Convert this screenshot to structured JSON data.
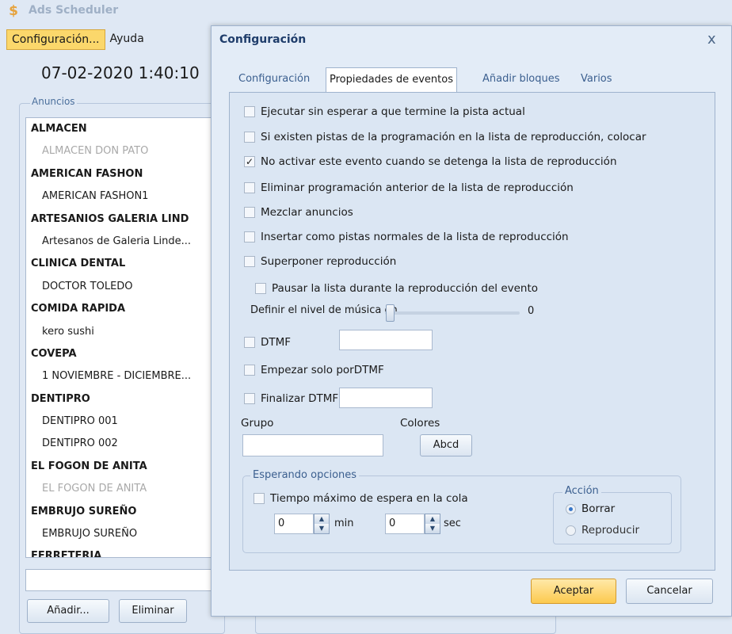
{
  "app": {
    "title": "Ads Scheduler",
    "menu": [
      "Configuración...",
      "Ayuda"
    ],
    "clock": "07-02-2020 1:40:10"
  },
  "ads": {
    "group_label": "Anuncios",
    "rows": [
      {
        "text": "ALMACEN",
        "kind": "group"
      },
      {
        "text": "ALMACEN DON PATO",
        "kind": "item-dim"
      },
      {
        "text": "AMERICAN FASHON",
        "kind": "group"
      },
      {
        "text": "AMERICAN FASHON1",
        "kind": "item"
      },
      {
        "text": "ARTESANIOS GALERIA LIND",
        "kind": "group"
      },
      {
        "text": "Artesanos de Galeria Linde...",
        "kind": "item"
      },
      {
        "text": "CLINICA DENTAL",
        "kind": "group"
      },
      {
        "text": "DOCTOR TOLEDO",
        "kind": "item"
      },
      {
        "text": "COMIDA RAPIDA",
        "kind": "group"
      },
      {
        "text": "kero sushi",
        "kind": "item"
      },
      {
        "text": "COVEPA",
        "kind": "group"
      },
      {
        "text": "1 NOVIEMBRE - DICIEMBRE...",
        "kind": "item"
      },
      {
        "text": "DENTIPRO",
        "kind": "group"
      },
      {
        "text": "DENTIPRO 001",
        "kind": "item"
      },
      {
        "text": "DENTIPRO 002",
        "kind": "item"
      },
      {
        "text": "EL FOGON DE ANITA",
        "kind": "group"
      },
      {
        "text": "EL FOGON DE ANITA",
        "kind": "item-dim"
      },
      {
        "text": "EMBRUJO SUREÑO",
        "kind": "group"
      },
      {
        "text": "EMBRUJO SUREÑO",
        "kind": "item"
      },
      {
        "text": "FERRETERIA",
        "kind": "group"
      }
    ],
    "add_label": "Añadir...",
    "delete_label": "Eliminar"
  },
  "dialog": {
    "title": "Configuración",
    "close": "x",
    "tabs": [
      "Configuración",
      "Propiedades de eventos",
      "Añadir bloques",
      "Varios"
    ],
    "active_tab": 1,
    "options": {
      "run_without_wait": {
        "label": "Ejecutar sin esperar a que termine la pista actual",
        "checked": false
      },
      "existing_tracks": {
        "label": "Si existen pistas de la programación en la lista de reproducción, colocar",
        "checked": false
      },
      "no_activate": {
        "label": "No activar este evento cuando se detenga la lista de reproducción",
        "checked": true
      },
      "remove_previous": {
        "label": "Eliminar programación anterior de la lista de reproducción",
        "checked": false
      },
      "mix_ads": {
        "label": "Mezclar anuncios",
        "checked": false
      },
      "insert_normal": {
        "label": "Insertar como pistas normales de la lista de reproducción",
        "checked": false
      },
      "overlay": {
        "label": "Superponer reproducción",
        "checked": false
      },
      "pause_list": {
        "label": "Pausar la lista durante la reproducción del evento",
        "checked": false
      },
      "dtmf": {
        "label": "DTMF",
        "checked": false
      },
      "start_dtmf": {
        "label": "Empezar solo porDTMF",
        "checked": false
      },
      "end_dtmf": {
        "label": "Finalizar DTMF",
        "checked": false
      }
    },
    "music_level": {
      "label": "Definir el nivel de música en",
      "value": "0"
    },
    "grupo_label": "Grupo",
    "colores_label": "Colores",
    "colores_button": "Abcd",
    "waiting": {
      "group_label": "Esperando opciones",
      "max_wait": {
        "label": "Tiempo máximo de espera en la cola",
        "checked": false
      },
      "min_value": "0",
      "min_unit": "min",
      "sec_value": "0",
      "sec_unit": "sec",
      "action_label": "Acción",
      "actions": [
        {
          "label": "Borrar",
          "selected": true
        },
        {
          "label": "Reproducir",
          "selected": false
        }
      ]
    },
    "ok_label": "Aceptar",
    "cancel_label": "Cancelar"
  }
}
